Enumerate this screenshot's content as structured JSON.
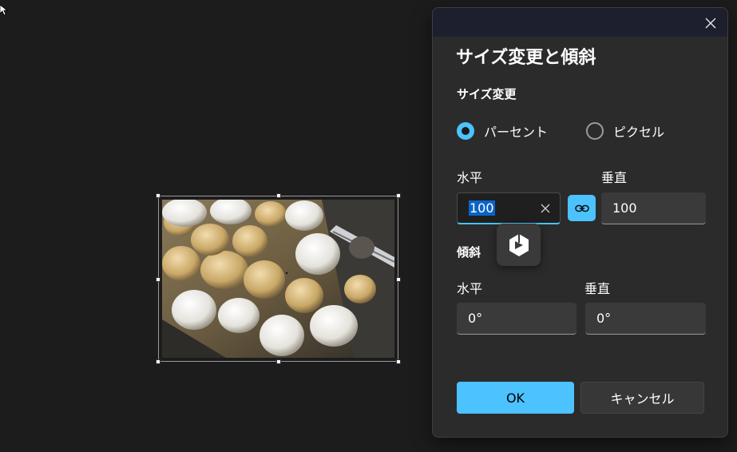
{
  "dialog": {
    "title": "サイズ変更と傾斜",
    "resize": {
      "section_label": "サイズ変更",
      "option_percent": "パーセント",
      "option_pixel": "ピクセル",
      "selected_option": "パーセント",
      "horizontal_label": "水平",
      "vertical_label": "垂直",
      "horizontal_value": "100",
      "vertical_value": "100",
      "aspect_locked": true
    },
    "skew": {
      "section_label": "傾斜",
      "horizontal_label": "水平",
      "vertical_label": "垂直",
      "horizontal_value": "0°",
      "vertical_value": "0°"
    },
    "ok_label": "OK",
    "cancel_label": "キャンセル"
  },
  "colors": {
    "accent": "#4cc2ff",
    "background": "#1c1c1c",
    "dialog_bg": "#2b2b2b"
  },
  "icons": [
    "cursor-icon",
    "close-icon",
    "clear-icon",
    "link-icon",
    "app-logo-icon"
  ]
}
